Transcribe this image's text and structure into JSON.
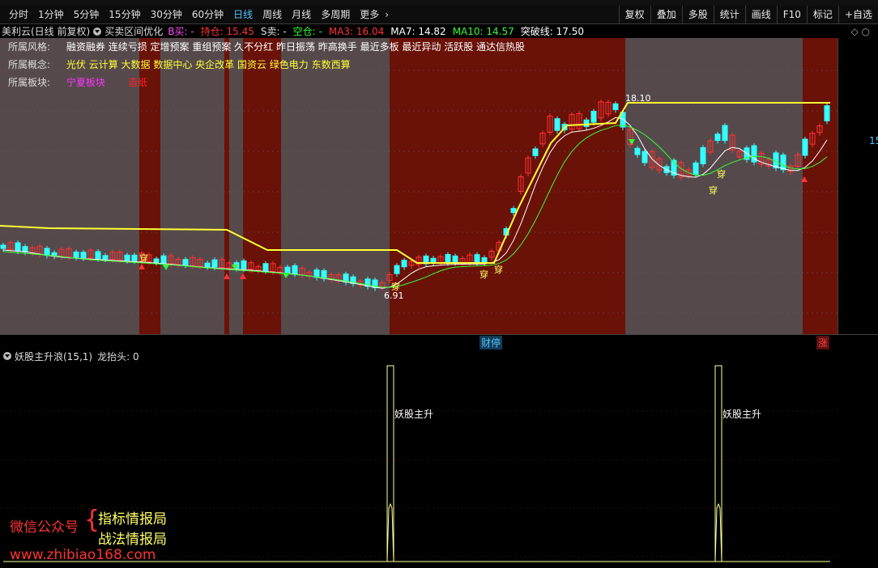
{
  "toolbar": {
    "periods": [
      "分时",
      "1分钟",
      "5分钟",
      "15分钟",
      "30分钟",
      "60分钟",
      "日线",
      "周线",
      "月线",
      "多周期",
      "更多"
    ],
    "active_period": "日线",
    "right_buttons": [
      "复权",
      "叠加",
      "多股",
      "统计",
      "画线",
      "F10",
      "标记",
      "+自选"
    ]
  },
  "title": {
    "stock": "美利云(日线 前复权)",
    "indicator": "买卖区间优化",
    "b_label": "B买: -",
    "hold_label": "持仓: 15.45",
    "s_label": "S卖: -",
    "empty_label": "空仓: -",
    "ma3": "MA3: 16.04",
    "ma7": "MA7: 14.82",
    "ma10": "MA10: 14.57",
    "breakout": "突破线: 17.50"
  },
  "info": {
    "style_label": "所属风格:",
    "style_value": "融资融券 连续亏损 定增预案 重组预案 久不分红 昨日振荡 昨高换手 最近多板 最近异动 活跃股 通达信热股",
    "concept_label": "所属概念:",
    "concept_value": "光伏 云计算 大数据 数据中心 央企改革 国资云 绿色电力 东数西算",
    "board_label": "所属板块:",
    "board_value1": "宁夏板块",
    "board_value2": "造纸"
  },
  "chart": {
    "high_label": "18.10",
    "low_label": "6.91",
    "cross_label": "穿",
    "scale_tick": "15",
    "bottom_tags": [
      "财停",
      "涨"
    ]
  },
  "indicator": {
    "title": "妖股主升浪(15,1)",
    "param": "龙抬头: 0",
    "signal_label": "妖股主升"
  },
  "watermark": {
    "left": "微信公众号",
    "line1": "指标情报局",
    "line2": "战法情报局",
    "url": "www.zhibiao168.com"
  },
  "colors": {
    "up": "#ff3333",
    "down": "#33ffff",
    "breakout": "#ffff33",
    "active": "#53c6ff"
  }
}
